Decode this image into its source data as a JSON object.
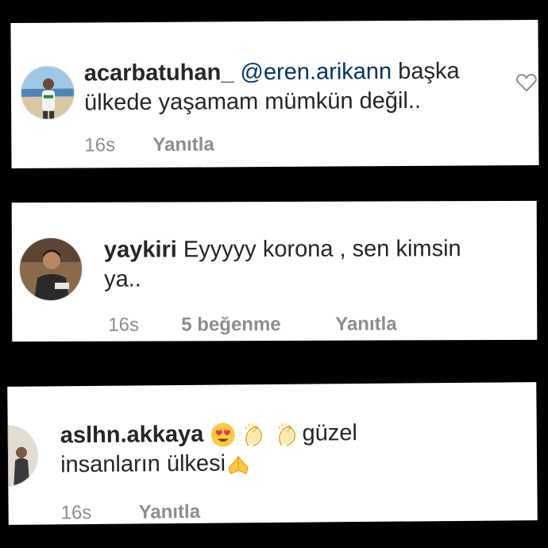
{
  "comments": [
    {
      "username": "acarbatuhan_",
      "mention": "@eren.arikann",
      "text_line1_rest": "başka",
      "text_line2": "ülkede yaşamam mümkün değil..",
      "time": "16s",
      "reply": "Yanıtla"
    },
    {
      "username": "yaykiri",
      "text_line1_rest": "Eyyyyy korona , sen kimsin",
      "text_line2": "ya..",
      "time": "16s",
      "likes": "5 beğenme",
      "reply": "Yanıtla"
    },
    {
      "username": "aslhn.akkaya",
      "text_line1_rest": "güzel",
      "text_line2": "insanların ülkesi",
      "emojis": [
        "smiling-face-with-heart-eyes",
        "clapping-hands",
        "clapping-hands",
        "folded-hands"
      ],
      "time": "16s",
      "reply": "Yanıtla"
    }
  ],
  "colors": {
    "background": "#000000",
    "card": "#ffffff",
    "text": "#262626",
    "mention": "#003569",
    "meta": "#8e8e8e",
    "emoji_yellow": "#ffc83d"
  }
}
